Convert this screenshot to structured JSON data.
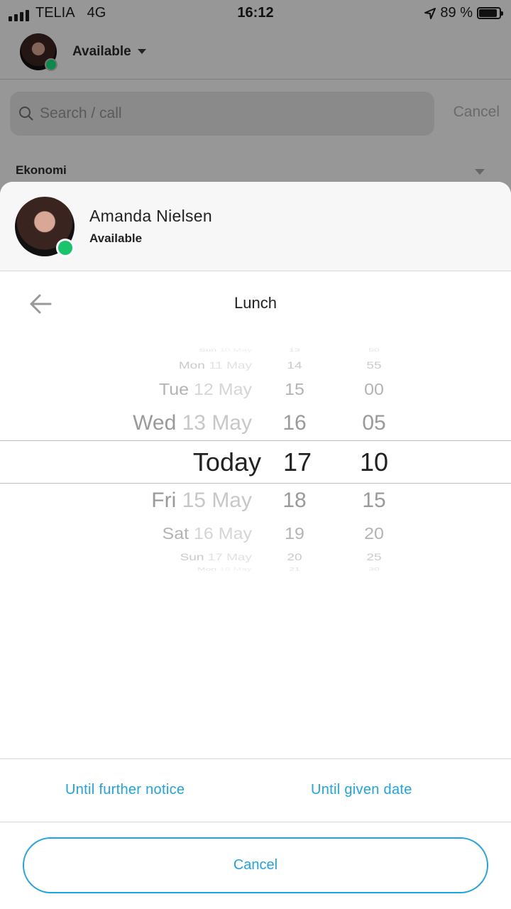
{
  "status_bar": {
    "carrier": "TELIA",
    "network": "4G",
    "time": "16:12",
    "battery": "89 %",
    "battery_level": 0.89
  },
  "header": {
    "status": "Available"
  },
  "search": {
    "placeholder": "Search / call",
    "cancel": "Cancel"
  },
  "group": {
    "name": "Ekonomi"
  },
  "sheet": {
    "user": {
      "name": "Amanda Nielsen",
      "status": "Available",
      "status_color": "#19c46c"
    },
    "title": "Lunch",
    "picker": {
      "rows": [
        {
          "day": "Sun",
          "date": "10 May",
          "hour": "13",
          "minute": "50"
        },
        {
          "day": "Mon",
          "date": "11 May",
          "hour": "14",
          "minute": "55"
        },
        {
          "day": "Tue",
          "date": "12 May",
          "hour": "15",
          "minute": "00"
        },
        {
          "day": "Wed",
          "date": "13 May",
          "hour": "16",
          "minute": "05"
        },
        {
          "day": "Today",
          "date": "",
          "hour": "17",
          "minute": "10",
          "selected": true
        },
        {
          "day": "Fri",
          "date": "15 May",
          "hour": "18",
          "minute": "15"
        },
        {
          "day": "Sat",
          "date": "16 May",
          "hour": "19",
          "minute": "20"
        },
        {
          "day": "Sun",
          "date": "17 May",
          "hour": "20",
          "minute": "25"
        },
        {
          "day": "Mon",
          "date": "18 May",
          "hour": "21",
          "minute": "30"
        }
      ]
    },
    "options": {
      "until_further_notice": "Until further notice",
      "until_given_date": "Until given date"
    },
    "cancel": "Cancel"
  },
  "accent_color": "#1ea4e6"
}
